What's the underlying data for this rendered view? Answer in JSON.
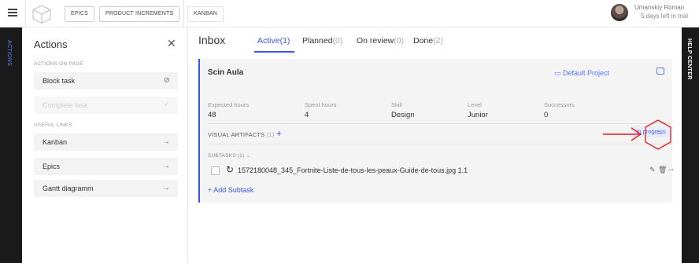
{
  "topbar": {
    "tags": [
      "EPICS",
      "PRODUCT INCREMENTS",
      "KANBAN"
    ],
    "user_name": "Umanskiy Roman",
    "trial": "5 days left in trial"
  },
  "sidebars": {
    "left_label": "ACTIONS",
    "right_label": "HELP CENTER"
  },
  "actions": {
    "title": "Actions",
    "section_on_page": "ACTIONS ON PAGE",
    "block_task": "Block task",
    "complete_task": "Complete task",
    "section_links": "USEFUL LINKS",
    "links": [
      "Kanban",
      "Epics",
      "Gantt diagramm"
    ]
  },
  "main": {
    "title": "Inbox",
    "tabs": [
      {
        "label": "Active",
        "count": "(1)"
      },
      {
        "label": "Planned",
        "count": "(0)"
      },
      {
        "label": "On review",
        "count": "(0)"
      },
      {
        "label": "Done",
        "count": "(2)"
      }
    ]
  },
  "card": {
    "title": "Scin Aula",
    "project": "Default Project",
    "fields": [
      {
        "label": "Expected hours",
        "value": "48"
      },
      {
        "label": "Spent hours",
        "value": "4"
      },
      {
        "label": "Skill",
        "value": "Design"
      },
      {
        "label": "Level",
        "value": "Junior"
      },
      {
        "label": "Successors",
        "value": "0"
      }
    ],
    "status": "In progress",
    "visual_artifacts": "VISUAL ARTIFACTS",
    "visual_artifacts_count": "(1)",
    "subtasks_label": "SUBTASKS (1)",
    "subtask_name": "1572180048_345_Fortnite-Liste-de-tous-les-peaux-Guide-de-tous.jpg 1.1",
    "add_subtask": "+ Add Subtask"
  },
  "icons": {
    "menu": "hamburger-icon",
    "logo": "cube-logo-icon",
    "close": "close-icon",
    "blocked": "block-icon",
    "check": "check-icon",
    "arrow": "arrow-right-icon",
    "comment": "comment-icon",
    "reload": "reload-icon",
    "edit": "pencil-icon",
    "delete": "trash-icon"
  },
  "colors": {
    "accent": "#3b55e6",
    "annotation": "#e21b1b",
    "sidebar_bg": "#1a1a1a"
  }
}
